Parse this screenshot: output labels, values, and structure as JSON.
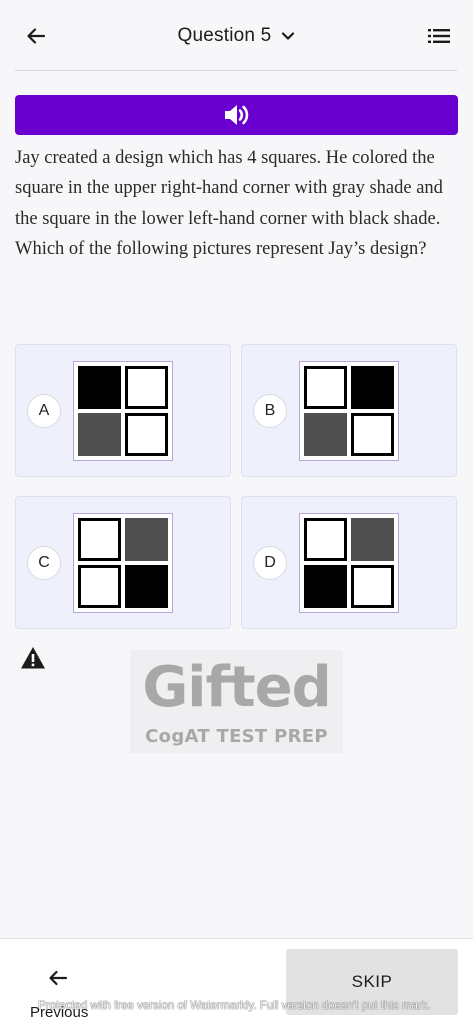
{
  "header": {
    "title": "Question 5",
    "back_icon": "arrow-left-icon",
    "dropdown_icon": "chevron-down-icon",
    "menu_icon": "list-icon"
  },
  "audio": {
    "icon": "speaker-icon",
    "color": "#6a00d0"
  },
  "question": {
    "text": "Jay created a design which has 4 squares. He colored the square in the upper right-hand corner with gray shade and the square in the lower left-hand corner with black shade. Which of the following pictures represent Jay’s design?"
  },
  "options": [
    {
      "letter": "A",
      "cells": [
        "black",
        "white",
        "gray",
        "white"
      ]
    },
    {
      "letter": "B",
      "cells": [
        "white",
        "black",
        "gray",
        "white"
      ]
    },
    {
      "letter": "C",
      "cells": [
        "white",
        "gray",
        "white",
        "black"
      ]
    },
    {
      "letter": "D",
      "cells": [
        "white",
        "gray",
        "black",
        "white"
      ]
    }
  ],
  "report_icon": "warning-icon",
  "logo": {
    "main": "Gifted",
    "sub": "CogAT TEST PREP"
  },
  "footer": {
    "previous_label": "Previous",
    "previous_icon": "arrow-left-icon",
    "skip_label": "SKIP"
  },
  "watermark": "Protected with free version of Watermarkly. Full version doesn't put this mark."
}
